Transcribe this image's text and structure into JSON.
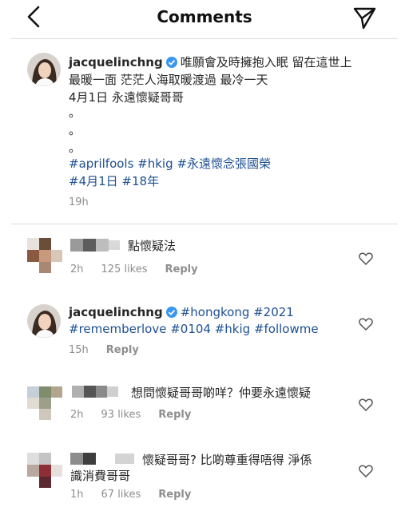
{
  "header": {
    "title": "Comments",
    "back_icon": "back-chevron-icon",
    "send_icon": "direct-send-icon"
  },
  "caption": {
    "username": "jacquelinchng",
    "text_line1": "唯願會及時擁抱入眠 留在這世上",
    "text_line2": "最暖一面 茫茫人海取暖渡過  最冷一天",
    "text_line3": "4月1日 永遠懷疑哥哥",
    "dots": [
      "。",
      "。",
      "。"
    ],
    "hashtags_line1": "#aprilfools #hkig #永遠懷念張國榮",
    "hashtags_line2": "#4月1日 #18年",
    "time": "19h"
  },
  "comments": [
    {
      "text": "點懷疑法",
      "time": "2h",
      "likes": "125 likes",
      "reply": "Reply"
    },
    {
      "username": "jacquelinchng",
      "text_line1": "#hongkong #2021",
      "text_line2": "#rememberlove #0104 #hkig #followme",
      "time": "15h",
      "reply": "Reply"
    },
    {
      "text": "想問懷疑哥哥啲咩？仲要永遠懷疑",
      "time": "2h",
      "likes": "93 likes",
      "reply": "Reply"
    },
    {
      "text_line1": "懷疑哥哥? 比啲尊重得唔得 淨係",
      "text_line2": "識消費哥哥",
      "time": "1h",
      "likes": "67 likes",
      "reply": "Reply"
    }
  ],
  "colors": {
    "hashtag": "#1d4f91",
    "verified": "#3897f0",
    "muted": "#8e8e8e"
  }
}
